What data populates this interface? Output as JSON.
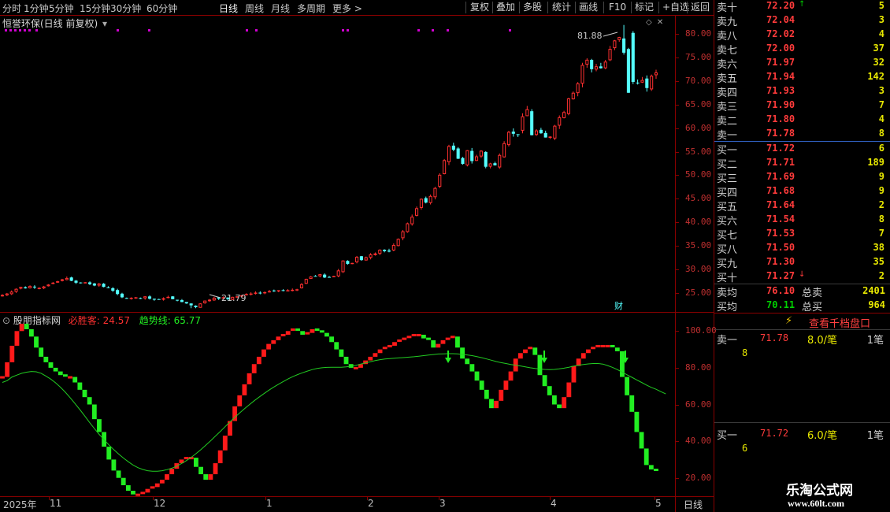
{
  "toolbar": {
    "periods": [
      "分时",
      "1分钟",
      "5分钟",
      "15分钟",
      "30分钟",
      "60分钟",
      "日线",
      "周线",
      "月线",
      "多周期",
      "更多"
    ],
    "active_period": "日线",
    "more_arrow": ">",
    "buttons": [
      "复权",
      "叠加",
      "多股",
      "统计",
      "画线",
      "F10",
      "标记",
      "+自选",
      "返回"
    ]
  },
  "main_chart": {
    "title": "恒誉环保(日线 前复权)",
    "dropdown_arrow": "▾",
    "high_label": "81.88",
    "low_label": "21.79",
    "fin_marker": "财",
    "y_ticks": [
      "80.00",
      "75.00",
      "70.00",
      "65.00",
      "60.00",
      "55.00",
      "50.00",
      "45.00",
      "40.00",
      "35.00",
      "30.00",
      "25.00"
    ]
  },
  "indicator": {
    "name": "股朋指标网",
    "line1_label": "必胜客:",
    "line1_value": "24.57",
    "line2_label": "趋势线:",
    "line2_value": "65.77",
    "y_ticks": [
      "100.00",
      "80.00",
      "60.00",
      "40.00",
      "20.00"
    ]
  },
  "date_axis": {
    "labels": [
      "2025年",
      "11",
      "12",
      "1",
      "2",
      "3",
      "4",
      "5"
    ],
    "period_button": "日线"
  },
  "order_book": {
    "asks": [
      {
        "label": "卖十",
        "price": "72.20",
        "vol": "5",
        "arrow": "↑"
      },
      {
        "label": "卖九",
        "price": "72.04",
        "vol": "3"
      },
      {
        "label": "卖八",
        "price": "72.02",
        "vol": "4"
      },
      {
        "label": "卖七",
        "price": "72.00",
        "vol": "37"
      },
      {
        "label": "卖六",
        "price": "71.97",
        "vol": "32"
      },
      {
        "label": "卖五",
        "price": "71.94",
        "vol": "142"
      },
      {
        "label": "卖四",
        "price": "71.93",
        "vol": "3"
      },
      {
        "label": "卖三",
        "price": "71.90",
        "vol": "7"
      },
      {
        "label": "卖二",
        "price": "71.80",
        "vol": "4"
      },
      {
        "label": "卖一",
        "price": "71.78",
        "vol": "8"
      }
    ],
    "bids": [
      {
        "label": "买一",
        "price": "71.72",
        "vol": "6"
      },
      {
        "label": "买二",
        "price": "71.71",
        "vol": "189"
      },
      {
        "label": "买三",
        "price": "71.69",
        "vol": "9"
      },
      {
        "label": "买四",
        "price": "71.68",
        "vol": "9"
      },
      {
        "label": "买五",
        "price": "71.64",
        "vol": "2"
      },
      {
        "label": "买六",
        "price": "71.54",
        "vol": "8"
      },
      {
        "label": "买七",
        "price": "71.53",
        "vol": "7"
      },
      {
        "label": "买八",
        "price": "71.50",
        "vol": "38"
      },
      {
        "label": "买九",
        "price": "71.30",
        "vol": "35"
      },
      {
        "label": "买十",
        "price": "71.27",
        "vol": "2",
        "arrow": "↓"
      }
    ],
    "avg_sell_label": "卖均",
    "avg_sell_price": "76.10",
    "total_sell_label": "总卖",
    "total_sell_vol": "2401",
    "avg_buy_label": "买均",
    "avg_buy_price": "70.11",
    "total_buy_label": "总买",
    "total_buy_vol": "964"
  },
  "thousand_depth": {
    "link_text": "查看千档盘口",
    "ask_label": "卖一",
    "ask_price": "71.78",
    "ask_per_trade": "8.0/笔",
    "ask_trades": "1笔",
    "ask_qty": "8",
    "bid_label": "买一",
    "bid_price": "71.72",
    "bid_per_trade": "6.0/笔",
    "bid_trades": "1笔",
    "bid_qty": "6"
  },
  "watermark": {
    "title": "乐淘公式网",
    "url": "www.60lt.com"
  },
  "colors": {
    "up": "#ff3030",
    "down": "#54ffff",
    "ind_up": "#ff1a1a",
    "ind_down": "#22ee22",
    "trend": "#22cc22",
    "frame": "#8a0000"
  },
  "chart_data": [
    {
      "type": "candlestick",
      "title": "恒誉环保(日线 前复权)",
      "ylim": [
        21,
        84
      ],
      "high": 81.88,
      "low": 21.79,
      "close_series": [
        24.6,
        24.9,
        25.3,
        25.9,
        26.3,
        26.0,
        26.5,
        26.2,
        26.1,
        26.4,
        26.8,
        27.2,
        27.5,
        27.9,
        28.2,
        27.6,
        27.2,
        27.1,
        27.3,
        26.9,
        26.6,
        27.0,
        26.3,
        26.1,
        25.5,
        24.8,
        24.1,
        23.9,
        24.0,
        24.1,
        23.9,
        24.3,
        23.8,
        23.6,
        23.7,
        23.9,
        24.2,
        23.7,
        23.4,
        23.1,
        22.8,
        22.4,
        22.0,
        22.8,
        23.4,
        23.6,
        24.0,
        23.8,
        24.1,
        23.7,
        24.2,
        24.3,
        24.5,
        24.8,
        24.9,
        25.1,
        25.0,
        25.2,
        25.4,
        25.5,
        25.6,
        25.5,
        25.6,
        25.7,
        25.8,
        26.9,
        28.0,
        28.5,
        28.6,
        29.0,
        28.3,
        28.4,
        28.6,
        29.8,
        31.9,
        31.2,
        31.4,
        32.7,
        32.0,
        32.6,
        33.2,
        33.4,
        34.2,
        33.9,
        33.8,
        35.2,
        36.5,
        38.1,
        39.8,
        41.2,
        43.0,
        45.0,
        44.2,
        45.6,
        47.3,
        50.1,
        53.2,
        56.2,
        55.4,
        53.5,
        52.4,
        55.3,
        53.0,
        54.0,
        55.2,
        51.8,
        52.5,
        52.1,
        54.3,
        56.8,
        59.2,
        58.8,
        58.7,
        62.5,
        64.0,
        58.5,
        59.5,
        58.9,
        58.0,
        58.2,
        60.5,
        62.3,
        63.4,
        66.3,
        67.5,
        69.5,
        73.4,
        74.5,
        72.5,
        73.1,
        72.7,
        74.1,
        76.8,
        78.6,
        79.3,
        76.0,
        67.5,
        69.8,
        69.6,
        70.2,
        68.5,
        71.1,
        71.8
      ]
    },
    {
      "type": "line",
      "series": [
        {
          "name": "必胜客",
          "values": [
            75,
            83,
            92,
            100,
            104,
            101,
            97,
            91,
            86,
            83,
            80,
            78,
            76,
            75,
            75,
            72,
            68,
            64,
            60,
            52,
            45,
            37,
            30,
            24,
            20,
            16,
            13,
            11,
            11,
            12,
            14,
            15,
            17,
            19,
            22,
            25,
            28,
            30,
            31,
            31,
            26,
            22,
            19,
            22,
            28,
            35,
            43,
            51,
            59,
            65,
            71,
            77,
            82,
            86,
            90,
            93,
            95,
            97,
            98,
            100,
            101,
            100,
            98,
            99,
            101,
            100,
            99,
            97,
            94,
            90,
            86,
            82,
            80,
            80,
            82,
            84,
            86,
            88,
            90,
            91,
            92,
            94,
            95,
            96,
            97,
            98,
            98,
            96,
            95,
            91,
            93,
            95,
            96,
            97,
            91,
            85,
            82,
            78,
            73,
            68,
            63,
            58,
            62,
            68,
            73,
            78,
            85,
            88,
            90,
            91,
            87,
            76,
            70,
            65,
            60,
            58,
            64,
            72,
            81,
            85,
            88,
            90,
            91,
            92,
            92,
            92,
            91,
            89,
            75,
            65,
            56,
            45,
            36,
            27,
            24.6,
            24.57
          ]
        },
        {
          "name": "趋势线",
          "values": [
            72,
            73,
            75,
            76,
            77,
            77.6,
            78,
            77.8,
            77,
            75.5,
            73.8,
            71.8,
            69.4,
            66.7,
            63.7,
            60.5,
            57.2,
            53.8,
            50.2,
            46.9,
            43.7,
            40.8,
            38,
            35.4,
            33,
            30.8,
            28.8,
            27,
            25.6,
            24.6,
            23.9,
            23.6,
            23.6,
            23.9,
            24.5,
            25.3,
            26.4,
            27.8,
            29.4,
            31.2,
            33.2,
            35.4,
            37.8,
            40.2,
            42.8,
            45.3,
            47.9,
            50.5,
            53,
            55.4,
            57.7,
            59.9,
            62,
            64,
            65.9,
            67.7,
            69.4,
            71,
            72.5,
            73.9,
            75.2,
            76.3,
            77.3,
            78.2,
            79,
            79.6,
            80,
            80.2,
            80.3,
            80.3,
            80.3,
            80.5,
            80.8,
            81.3,
            82,
            82.7,
            83.3,
            83.9,
            84.4,
            84.8,
            85,
            85.2,
            85.4,
            85.6,
            85.8,
            86,
            86.3,
            86.6,
            86.9,
            87.2,
            87.5,
            87.6,
            87.7,
            87.7,
            87.6,
            87.3,
            87,
            86.6,
            86.1,
            85.5,
            84.8,
            84.1,
            83.4,
            82.8,
            82.3,
            81.8,
            81.4,
            81,
            80.5,
            80,
            79.6,
            79.3,
            79.1,
            79,
            79.1,
            79.4,
            79.8,
            80.3,
            80.9,
            81.4,
            81.8,
            82.1,
            82.3,
            82.3,
            82,
            81.2,
            80.2,
            79,
            77.6,
            76.2,
            74.8,
            73.4,
            72,
            70.6,
            69.3,
            68.3,
            67,
            65.77
          ]
        }
      ],
      "ylim": [
        10,
        110
      ]
    }
  ]
}
